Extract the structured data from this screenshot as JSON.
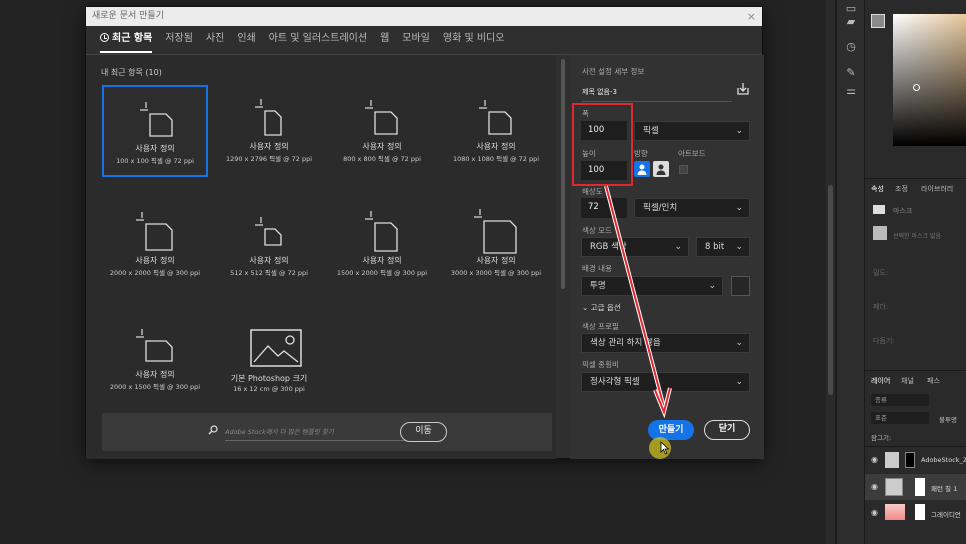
{
  "dialog": {
    "title": "새로운 문서 만들기",
    "close": "×"
  },
  "tabs": [
    "최근 항목",
    "저장됨",
    "사진",
    "인쇄",
    "아트 및 일러스트레이션",
    "웹",
    "모바일",
    "영화 및 비디오"
  ],
  "recent_header": "내 최근 항목 (10)",
  "presets": [
    {
      "name": "사용자 정의",
      "size": "100 x 100 픽셀 @ 72 ppi"
    },
    {
      "name": "사용자 정의",
      "size": "1290 x 2796 픽셀 @ 72 ppi"
    },
    {
      "name": "사용자 정의",
      "size": "800 x 800 픽셀 @ 72 ppi"
    },
    {
      "name": "사용자 정의",
      "size": "1080 x 1080 픽셀 @ 72 ppi"
    },
    {
      "name": "사용자 정의",
      "size": "2000 x 2000 픽셀 @ 300 ppi"
    },
    {
      "name": "사용자 정의",
      "size": "512 x 512 픽셀 @ 72 ppi"
    },
    {
      "name": "사용자 정의",
      "size": "1500 x 2000 픽셀 @ 300 ppi"
    },
    {
      "name": "사용자 정의",
      "size": "3000 x 3000 픽셀 @ 300 ppi"
    },
    {
      "name": "사용자 정의",
      "size": "2000 x 1500 픽셀 @ 300 ppi"
    },
    {
      "name": "기본 Photoshop 크기",
      "size": "16 x 12 cm @ 300 ppi"
    }
  ],
  "search": {
    "placeholder": "Adobe Stock에서 더 많은 템플릿 찾기",
    "go": "이동"
  },
  "details": {
    "header": "사전 설정 세부 정보",
    "doc_name": "제목 없음-3",
    "width_label": "폭",
    "width": "100",
    "width_unit": "픽셀",
    "height_label": "높이",
    "height": "100",
    "orientation_label": "방향",
    "artboard_label": "아트보드",
    "resolution_label": "해상도",
    "resolution": "72",
    "resolution_unit": "픽셀/인치",
    "color_mode_label": "색상 모드",
    "color_mode": "RGB 색상",
    "bit_depth": "8 bit",
    "background_label": "배경 내용",
    "background": "투명",
    "advanced": "고급 옵션",
    "color_profile_label": "색상 프로필",
    "color_profile": "색상 관리 하지 않음",
    "pixel_aspect_label": "픽셀 종횡비",
    "pixel_aspect": "정사각형 픽셀",
    "create": "만들기",
    "close": "닫기"
  },
  "right_panel": {
    "props_tab": "속성",
    "adjust_tab": "조정",
    "library_tab": "라이브러리",
    "mask": "마스크",
    "mask_hint": "선택한 마스크 없음",
    "density": "밀도:",
    "feather": "페더:",
    "refine": "다듬기:",
    "layers_tab": "레이어",
    "channels_tab": "채널",
    "paths_tab": "패스",
    "kind": "종류",
    "normal": "표준",
    "opacity": "불투명",
    "lock": "잠그기:",
    "layers": [
      "AdobeStock_2",
      "패턴 칠 1",
      "그레이디언"
    ]
  },
  "colors": {
    "accent": "#1473e6",
    "highlight": "#e0282e"
  }
}
